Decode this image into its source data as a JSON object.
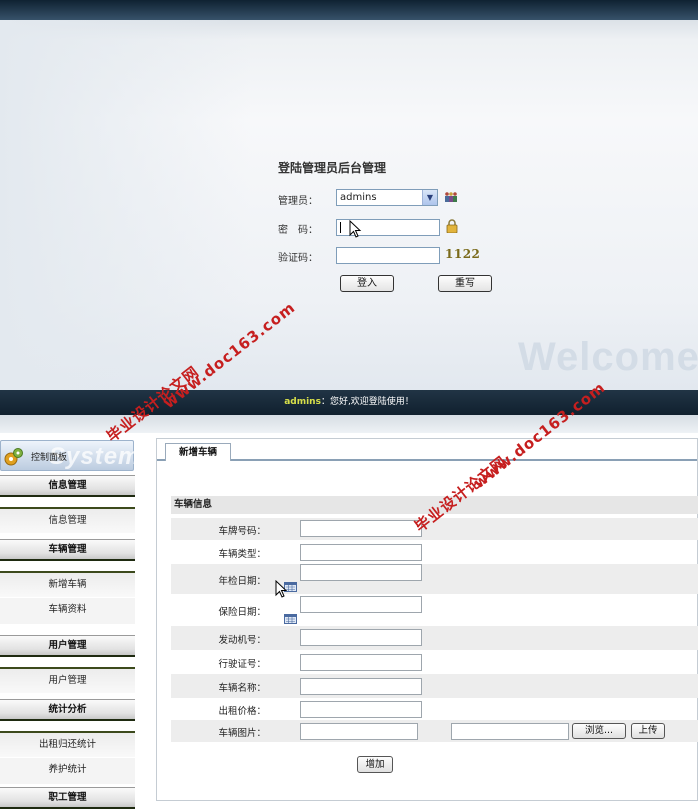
{
  "login": {
    "title": "登陆管理员后台管理",
    "admin_label": "管理员：",
    "admin_selected": "admins",
    "password_label": "密　码：",
    "captcha_label": "验证码：",
    "captcha_code": "1122",
    "login_button": "登入",
    "reset_button": "重写",
    "welcome_text": "Welcome"
  },
  "status_bar": {
    "username": "admins",
    "message": "：您好,欢迎登陆使用！"
  },
  "sidebar": {
    "control_panel": "控制面板",
    "control_panel_ghost": "System",
    "sections": [
      {
        "title": "信息管理",
        "items": [
          "信息管理"
        ]
      },
      {
        "title": "车辆管理",
        "items": [
          "新增车辆",
          "车辆资料"
        ]
      },
      {
        "title": "用户管理",
        "items": [
          "用户管理"
        ]
      },
      {
        "title": "统计分析",
        "items": [
          "出租归还统计",
          "养护统计"
        ]
      },
      {
        "title": "职工管理",
        "items": []
      }
    ]
  },
  "main": {
    "tab": "新增车辆",
    "section_title": "车辆信息",
    "fields": [
      {
        "label": "车牌号码："
      },
      {
        "label": "车辆类型："
      },
      {
        "label": "年检日期："
      },
      {
        "label": "保险日期："
      },
      {
        "label": "发动机号："
      },
      {
        "label": "行驶证号："
      },
      {
        "label": "车辆名称："
      },
      {
        "label": "出租价格："
      },
      {
        "label": "车辆图片："
      }
    ],
    "browse_button": "浏览...",
    "upload_button": "上传",
    "add_button": "增加"
  },
  "watermarks": {
    "line1": "毕业设计论文网",
    "line2": "www.doc163.com"
  },
  "colors": {
    "watermark": "#c61f1f",
    "username_highlight": "#d8e04a",
    "status_bar_bg": "#213445"
  }
}
